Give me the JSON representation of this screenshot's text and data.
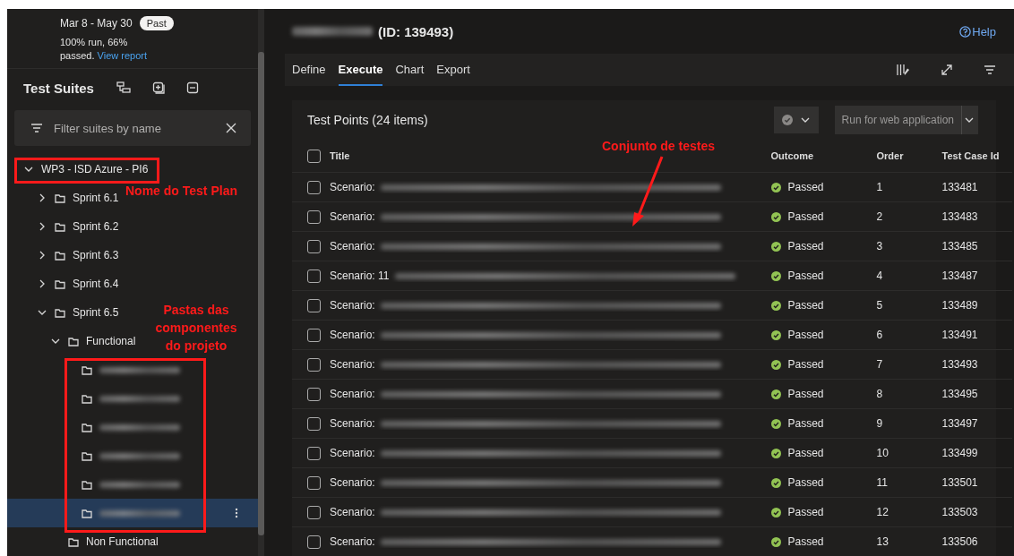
{
  "plan": {
    "dates": "Mar 8 - May 30",
    "badge": "Past",
    "summary": "100% run, 66%",
    "summary_end": "passed.",
    "report_link": "View report"
  },
  "suites": {
    "title": "Test Suites",
    "filter_placeholder": "Filter suites by name",
    "tree": [
      {
        "kind": "plan",
        "label": "WP3 - ISD Azure - PI6",
        "expanded": true,
        "selected": false,
        "children": [
          {
            "kind": "folder",
            "label": "Sprint 6.1",
            "expanded": false,
            "selected": false
          },
          {
            "kind": "folder",
            "label": "Sprint 6.2",
            "expanded": false,
            "selected": false
          },
          {
            "kind": "folder",
            "label": "Sprint 6.3",
            "expanded": false,
            "selected": false
          },
          {
            "kind": "folder",
            "label": "Sprint 6.4",
            "expanded": false,
            "selected": false
          },
          {
            "kind": "folder",
            "label": "Sprint 6.5",
            "expanded": true,
            "selected": false,
            "children": [
              {
                "kind": "folder",
                "label": "Functional",
                "expanded": true,
                "selected": false,
                "children": [
                  {
                    "kind": "blurred",
                    "selected": false
                  },
                  {
                    "kind": "blurred",
                    "selected": false
                  },
                  {
                    "kind": "blurred",
                    "selected": false
                  },
                  {
                    "kind": "blurred",
                    "selected": false
                  },
                  {
                    "kind": "blurred",
                    "selected": false
                  },
                  {
                    "kind": "blurred",
                    "selected": true
                  }
                ]
              },
              {
                "kind": "folder",
                "label": "Non Functional",
                "selected": false
              }
            ]
          }
        ]
      }
    ]
  },
  "header": {
    "title": "(ID: 139493)",
    "help": "Help"
  },
  "tabs": [
    {
      "label": "Define",
      "selected": false
    },
    {
      "label": "Execute",
      "selected": true
    },
    {
      "label": "Chart",
      "selected": false
    },
    {
      "label": "Export",
      "selected": false
    }
  ],
  "test_points": {
    "title": "Test Points (24 items)",
    "run_button": "Run for web application",
    "select_all_checked": false,
    "columns": [
      "Title",
      "Outcome",
      "Order",
      "Test Case Id"
    ],
    "rows": [
      {
        "checked": false,
        "title": "Scenario:",
        "outcome": "Passed",
        "order": "1",
        "test_case_id": "133481"
      },
      {
        "checked": false,
        "title": "Scenario:",
        "outcome": "Passed",
        "order": "2",
        "test_case_id": "133483"
      },
      {
        "checked": false,
        "title": "Scenario:",
        "outcome": "Passed",
        "order": "3",
        "test_case_id": "133485"
      },
      {
        "checked": false,
        "title": "Scenario: 11",
        "outcome": "Passed",
        "order": "4",
        "test_case_id": "133487"
      },
      {
        "checked": false,
        "title": "Scenario:",
        "outcome": "Passed",
        "order": "5",
        "test_case_id": "133489"
      },
      {
        "checked": false,
        "title": "Scenario:",
        "outcome": "Passed",
        "order": "6",
        "test_case_id": "133491"
      },
      {
        "checked": false,
        "title": "Scenario:",
        "outcome": "Passed",
        "order": "7",
        "test_case_id": "133493"
      },
      {
        "checked": false,
        "title": "Scenario:",
        "outcome": "Passed",
        "order": "8",
        "test_case_id": "133495"
      },
      {
        "checked": false,
        "title": "Scenario:",
        "outcome": "Passed",
        "order": "9",
        "test_case_id": "133497"
      },
      {
        "checked": false,
        "title": "Scenario:",
        "outcome": "Passed",
        "order": "10",
        "test_case_id": "133499"
      },
      {
        "checked": false,
        "title": "Scenario:",
        "outcome": "Passed",
        "order": "11",
        "test_case_id": "133501"
      },
      {
        "checked": false,
        "title": "Scenario:",
        "outcome": "Passed",
        "order": "12",
        "test_case_id": "133503"
      },
      {
        "checked": false,
        "title": "Scenario:",
        "outcome": "Passed",
        "order": "13",
        "test_case_id": "133506"
      }
    ]
  },
  "annotations": [
    {
      "kind": "box"
    },
    {
      "kind": "label",
      "text": "Nome do Test Plan"
    },
    {
      "kind": "box"
    },
    {
      "kind": "label",
      "text": "Pastas das componentes do projeto"
    },
    {
      "kind": "label",
      "text": "Conjunto de testes"
    },
    {
      "kind": "arrow"
    }
  ]
}
